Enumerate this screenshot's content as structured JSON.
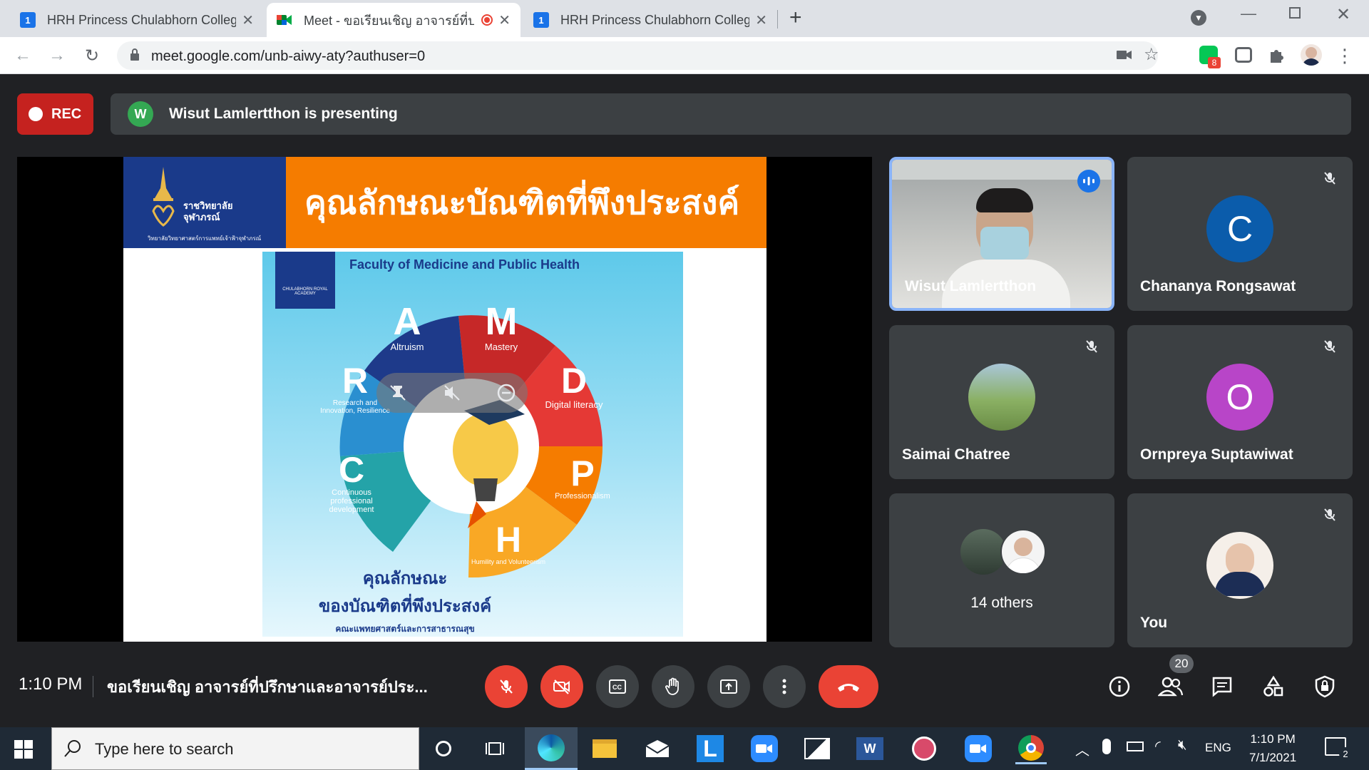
{
  "tabs": [
    {
      "title": "HRH Princess Chulabhorn College",
      "favicon": "calendar-icon",
      "active": false
    },
    {
      "title": "Meet - ขอเรียนเชิญ อาจารย์ที่ป",
      "favicon": "meet-icon",
      "active": true
    },
    {
      "title": "HRH Princess Chulabhorn College",
      "favicon": "calendar-icon",
      "active": false
    }
  ],
  "address": {
    "url": "meet.google.com/unb-aiwy-aty?authuser=0"
  },
  "extensions": {
    "line_badge": "8"
  },
  "meet": {
    "rec_label": "REC",
    "presenter_initial": "W",
    "presenting_text": "Wisut Lamlertthon is presenting",
    "slide": {
      "header_title": "คุณลักษณะบัณฑิตที่พึงประสงค์",
      "logo_line1": "ราชวิทยาลัย",
      "logo_line2": "จุฬาภรณ์",
      "logo_caption": "วิทยาลัยวิทยาศาสตร์การแพทย์เจ้าฟ้าจุฬาภรณ์",
      "poster_title": "Faculty of Medicine and Public Health",
      "poster_logo_text": "CHULABHORN ROYAL ACADEMY",
      "segments": [
        {
          "letter": "A",
          "label": "Altruism"
        },
        {
          "letter": "M",
          "label": "Mastery"
        },
        {
          "letter": "D",
          "label": "Digital literacy"
        },
        {
          "letter": "P",
          "label": "Professionalism"
        },
        {
          "letter": "H",
          "label": "Humility and Volunteerism"
        },
        {
          "letter": "C",
          "label": "Continuous professional development"
        },
        {
          "letter": "R",
          "label": "Research and Innovation, Resilience"
        }
      ],
      "poster_caption1": "คุณลักษณะ",
      "poster_caption2": "ของบัณฑิตที่พึงประสงค์",
      "poster_caption3": "คณะแพทยศาสตร์และการสาธารณสุข"
    },
    "participants": [
      {
        "name": "Wisut Lamlertthon",
        "initial": "",
        "speaking": true
      },
      {
        "name": "Chananya Rongsawat",
        "initial": "C",
        "color": "#0b5cab"
      },
      {
        "name": "Saimai Chatree",
        "initial": ""
      },
      {
        "name": "Ornpreya Suptawiwat",
        "initial": "O",
        "color": "#b845c8"
      },
      {
        "name": "14 others",
        "initial": ""
      },
      {
        "name": "You",
        "initial": ""
      }
    ],
    "bottom": {
      "time": "1:10 PM",
      "meeting_name": "ขอเรียนเชิญ อาจารย์ที่ปรึกษาและอาจารย์ประ...",
      "people_count": "20"
    }
  },
  "taskbar": {
    "search_placeholder": "Type here to search",
    "language": "ENG",
    "time": "1:10 PM",
    "date": "7/1/2021",
    "notification_count": "2"
  }
}
